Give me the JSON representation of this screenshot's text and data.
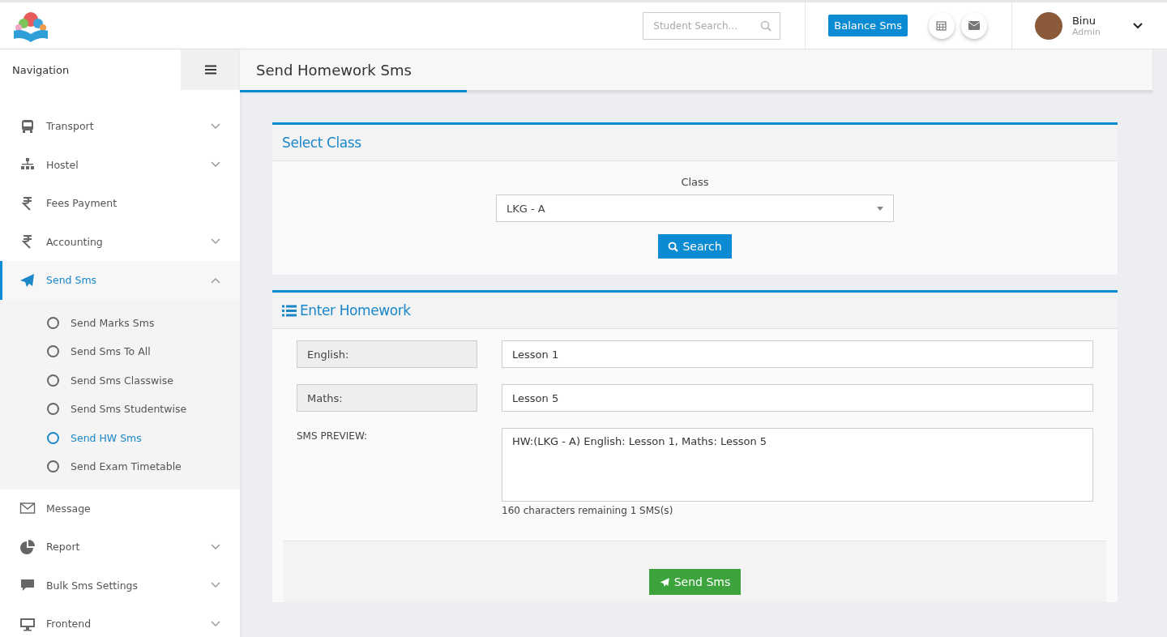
{
  "header": {
    "search": {
      "placeholder": "Student Search..."
    },
    "balance_button": "Balance Sms",
    "user": {
      "name": "Binu",
      "role": "Admin"
    }
  },
  "sidebar": {
    "title": "Navigation",
    "items": [
      {
        "label": "Transport",
        "kind": "group",
        "expanded": false,
        "selected": false
      },
      {
        "label": "Hostel",
        "kind": "group",
        "expanded": false,
        "selected": false
      },
      {
        "label": "Fees Payment",
        "kind": "link",
        "selected": false
      },
      {
        "label": "Accounting",
        "kind": "group",
        "expanded": false,
        "selected": false
      },
      {
        "label": "Send Sms",
        "kind": "group",
        "expanded": true,
        "selected": true,
        "children": [
          {
            "label": "Send Marks Sms",
            "selected": false
          },
          {
            "label": "Send Sms To All",
            "selected": false
          },
          {
            "label": "Send Sms Classwise",
            "selected": false
          },
          {
            "label": "Send Sms Studentwise",
            "selected": false
          },
          {
            "label": "Send HW Sms",
            "selected": true
          },
          {
            "label": "Send Exam Timetable",
            "selected": false
          }
        ]
      },
      {
        "label": "Message",
        "kind": "link",
        "selected": false
      },
      {
        "label": "Report",
        "kind": "group",
        "expanded": false,
        "selected": false
      },
      {
        "label": "Bulk Sms Settings",
        "kind": "group",
        "expanded": false,
        "selected": false
      },
      {
        "label": "Frontend",
        "kind": "group",
        "expanded": false,
        "selected": false
      }
    ]
  },
  "page_title": "Send Homework Sms",
  "select_class": {
    "title": "Select Class",
    "label": "Class",
    "value": "LKG - A",
    "button": "Search"
  },
  "homework": {
    "title": "Enter Homework",
    "subjects": [
      {
        "label": "English:",
        "value": "Lesson 1"
      },
      {
        "label": "Maths:",
        "value": "Lesson 5"
      }
    ],
    "preview_label": "SMS PREVIEW:",
    "preview": "HW:(LKG - A) English: Lesson 1, Maths: Lesson 5",
    "counter": "160 characters remaining 1 SMS(s)",
    "button": "Send Sms"
  }
}
